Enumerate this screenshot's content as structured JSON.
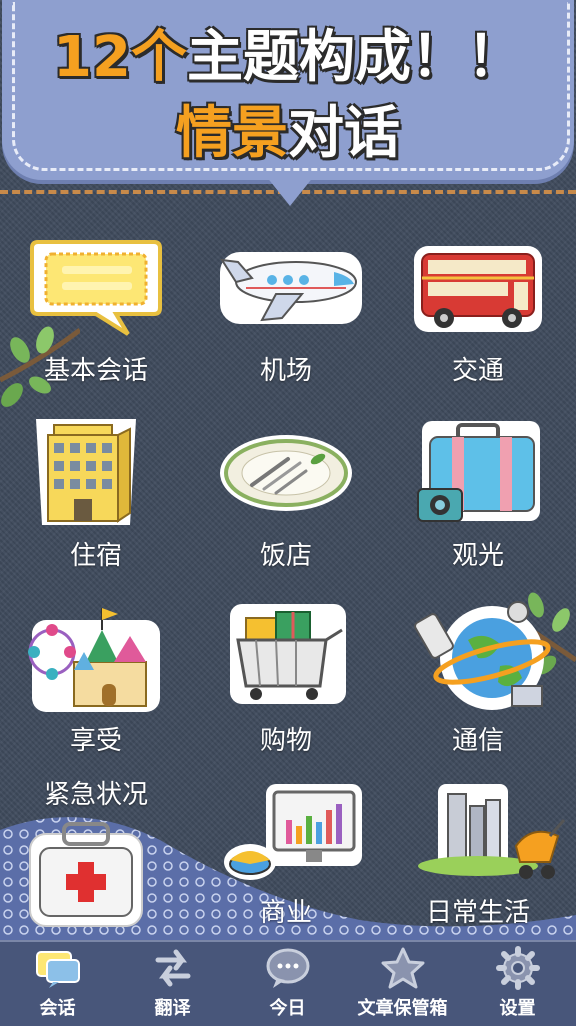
{
  "banner": {
    "line1_accent": "12个",
    "line1_rest": "主题构成！！",
    "line2_accent": "情景",
    "line2_rest": "对话"
  },
  "topics": [
    {
      "label": "基本会话",
      "icon": "speech-bubble-icon"
    },
    {
      "label": "机场",
      "icon": "airplane-icon"
    },
    {
      "label": "交通",
      "icon": "bus-icon"
    },
    {
      "label": "住宿",
      "icon": "hotel-icon"
    },
    {
      "label": "饭店",
      "icon": "plate-icon"
    },
    {
      "label": "观光",
      "icon": "suitcase-camera-icon"
    },
    {
      "label": "享受",
      "icon": "amusement-park-icon"
    },
    {
      "label": "购物",
      "icon": "shopping-cart-icon"
    },
    {
      "label": "通信",
      "icon": "globe-phone-icon"
    },
    {
      "label": "紧急状况",
      "icon": "first-aid-kit-icon"
    },
    {
      "label": "商业",
      "icon": "business-chart-icon"
    },
    {
      "label": "日常生活",
      "icon": "city-stroller-icon"
    }
  ],
  "tabbar": {
    "items": [
      {
        "label": "会话",
        "icon": "chat-bubbles-icon"
      },
      {
        "label": "翻译",
        "icon": "swap-arrows-icon"
      },
      {
        "label": "今日",
        "icon": "speech-dots-icon"
      },
      {
        "label": "文章保管箱",
        "icon": "star-icon"
      },
      {
        "label": "设置",
        "icon": "gear-icon"
      }
    ]
  },
  "colors": {
    "banner": "#8e9fcf",
    "accent": "#f5a020",
    "denim": "#3f4b5d",
    "tabbar": "#48567a"
  }
}
